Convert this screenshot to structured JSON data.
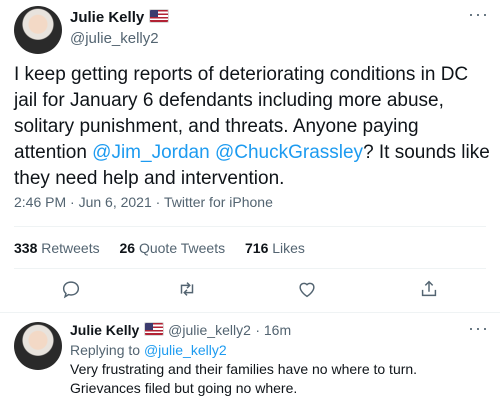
{
  "tweet": {
    "author_name": "Julie Kelly",
    "author_handle": "@julie_kelly2",
    "text_part1": "I keep getting reports of deteriorating conditions in DC jail for January 6 defendants including more abuse, solitary punishment, and threats. Anyone paying attention ",
    "mention1": "@Jim_Jordan",
    "mention2": "@ChuckGrassley",
    "text_part2": "? It sounds like they need help and intervention.",
    "timestamp": "2:46 PM · Jun 6, 2021 · Twitter for iPhone",
    "retweets_count": "338",
    "retweets_label": "Retweets",
    "quotes_count": "26",
    "quotes_label": "Quote Tweets",
    "likes_count": "716",
    "likes_label": "Likes"
  },
  "actions": {
    "reply_icon": "reply-icon",
    "retweet_icon": "retweet-icon",
    "like_icon": "heart-icon",
    "share_icon": "share-icon"
  },
  "reply": {
    "author_name": "Julie Kelly",
    "author_handle": "@julie_kelly2",
    "time": "· 16m",
    "replying_prefix": "Replying to",
    "replying_handle": "@julie_kelly2",
    "text": "Very frustrating and their families have no where to turn. Grievances filed but going no where."
  },
  "colors": {
    "accent": "#1d9bf0",
    "muted": "#536471",
    "divider": "#eff3f4"
  }
}
